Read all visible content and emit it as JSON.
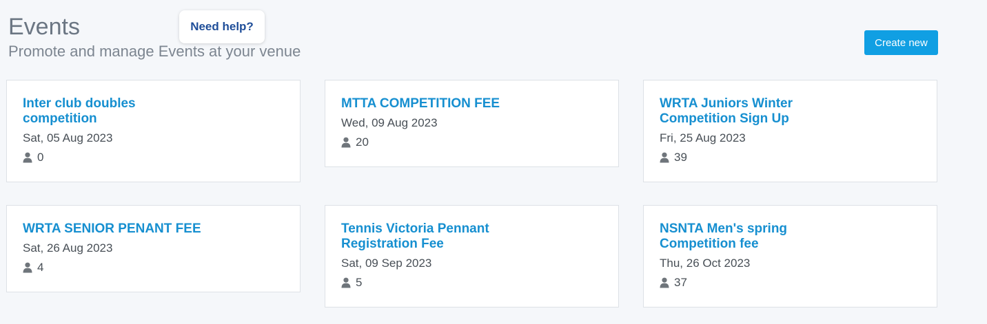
{
  "header": {
    "title": "Events",
    "subtitle": "Promote and manage Events at your venue",
    "help_label": "Need help?",
    "create_label": "Create new"
  },
  "events": [
    {
      "title": "Inter club doubles competition",
      "date": "Sat, 05 Aug 2023",
      "attendees": "0"
    },
    {
      "title": "MTTA COMPETITION FEE",
      "date": "Wed, 09 Aug 2023",
      "attendees": "20"
    },
    {
      "title": "WRTA Juniors Winter Competition Sign Up",
      "date": "Fri, 25 Aug 2023",
      "attendees": "39"
    },
    {
      "title": "WRTA SENIOR PENANT FEE",
      "date": "Sat, 26 Aug 2023",
      "attendees": "4"
    },
    {
      "title": "Tennis Victoria Pennant Registration Fee",
      "date": "Sat, 09 Sep 2023",
      "attendees": "5"
    },
    {
      "title": "NSNTA Men's spring Competition fee",
      "date": "Thu, 26 Oct 2023",
      "attendees": "37"
    }
  ],
  "icons": {
    "attendees": "user-icon"
  },
  "colors": {
    "accent": "#109fe3",
    "link": "#168fd0",
    "help_text": "#1f4e99"
  }
}
